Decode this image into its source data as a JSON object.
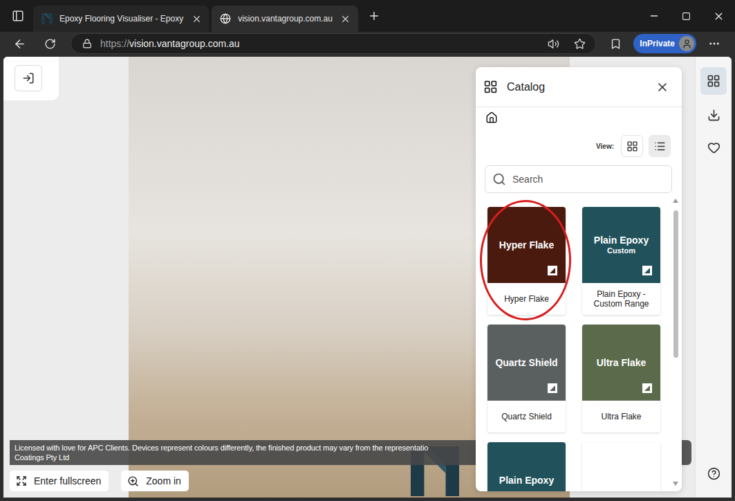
{
  "browser": {
    "tabs": [
      {
        "label": "Epoxy Flooring Visualiser - Epoxy",
        "selected": false,
        "kind": "site"
      },
      {
        "label": "vision.vantagroup.com.au",
        "selected": true,
        "kind": "globe"
      }
    ],
    "url_scheme": "https://",
    "url_host": "vision.vantagroup.com.au",
    "profile": "InPrivate"
  },
  "caption": {
    "line1": "Licensed with love for APC Clients. Devices represent colours differently, the finished product may vary from the representatio",
    "line2": "Coatings Pty Ltd"
  },
  "controls": [
    {
      "label": "Enter fullscreen",
      "kind": "fullscreen"
    },
    {
      "label": "Zoom in",
      "kind": "zoom"
    }
  ],
  "catalog": {
    "title": "Catalog",
    "view_label": "View:",
    "view_modes": [
      {
        "kind": "grid",
        "selected": false
      },
      {
        "kind": "list",
        "selected": true
      }
    ],
    "search_placeholder": "Search",
    "items": [
      {
        "kind": "swatch",
        "title": "Hyper Flake",
        "name": "Hyper Flake",
        "color": "#4b1a0f",
        "circled": true
      },
      {
        "kind": "swatch",
        "title": "Plain Epoxy",
        "subtitle": "Custom",
        "name": "Plain Epoxy - Custom Range",
        "color": "#21525b",
        "circled": false
      },
      {
        "kind": "swatch",
        "title": "Quartz Shield",
        "name": "Quartz Shield",
        "color": "#5a5f60",
        "circled": false
      },
      {
        "kind": "swatch",
        "title": "Ultra Flake",
        "name": "Ultra Flake",
        "color": "#5a6a4b",
        "circled": false
      },
      {
        "kind": "swatch",
        "title": "Plain Epoxy",
        "color": "#21525b",
        "circled": false
      },
      {
        "kind": "placeholder",
        "circled": false
      }
    ]
  },
  "rail": [
    {
      "kind": "catalog",
      "selected": true
    },
    {
      "kind": "download",
      "selected": false
    },
    {
      "kind": "favorites",
      "selected": false
    },
    {
      "kind": "help",
      "selected": false
    }
  ]
}
